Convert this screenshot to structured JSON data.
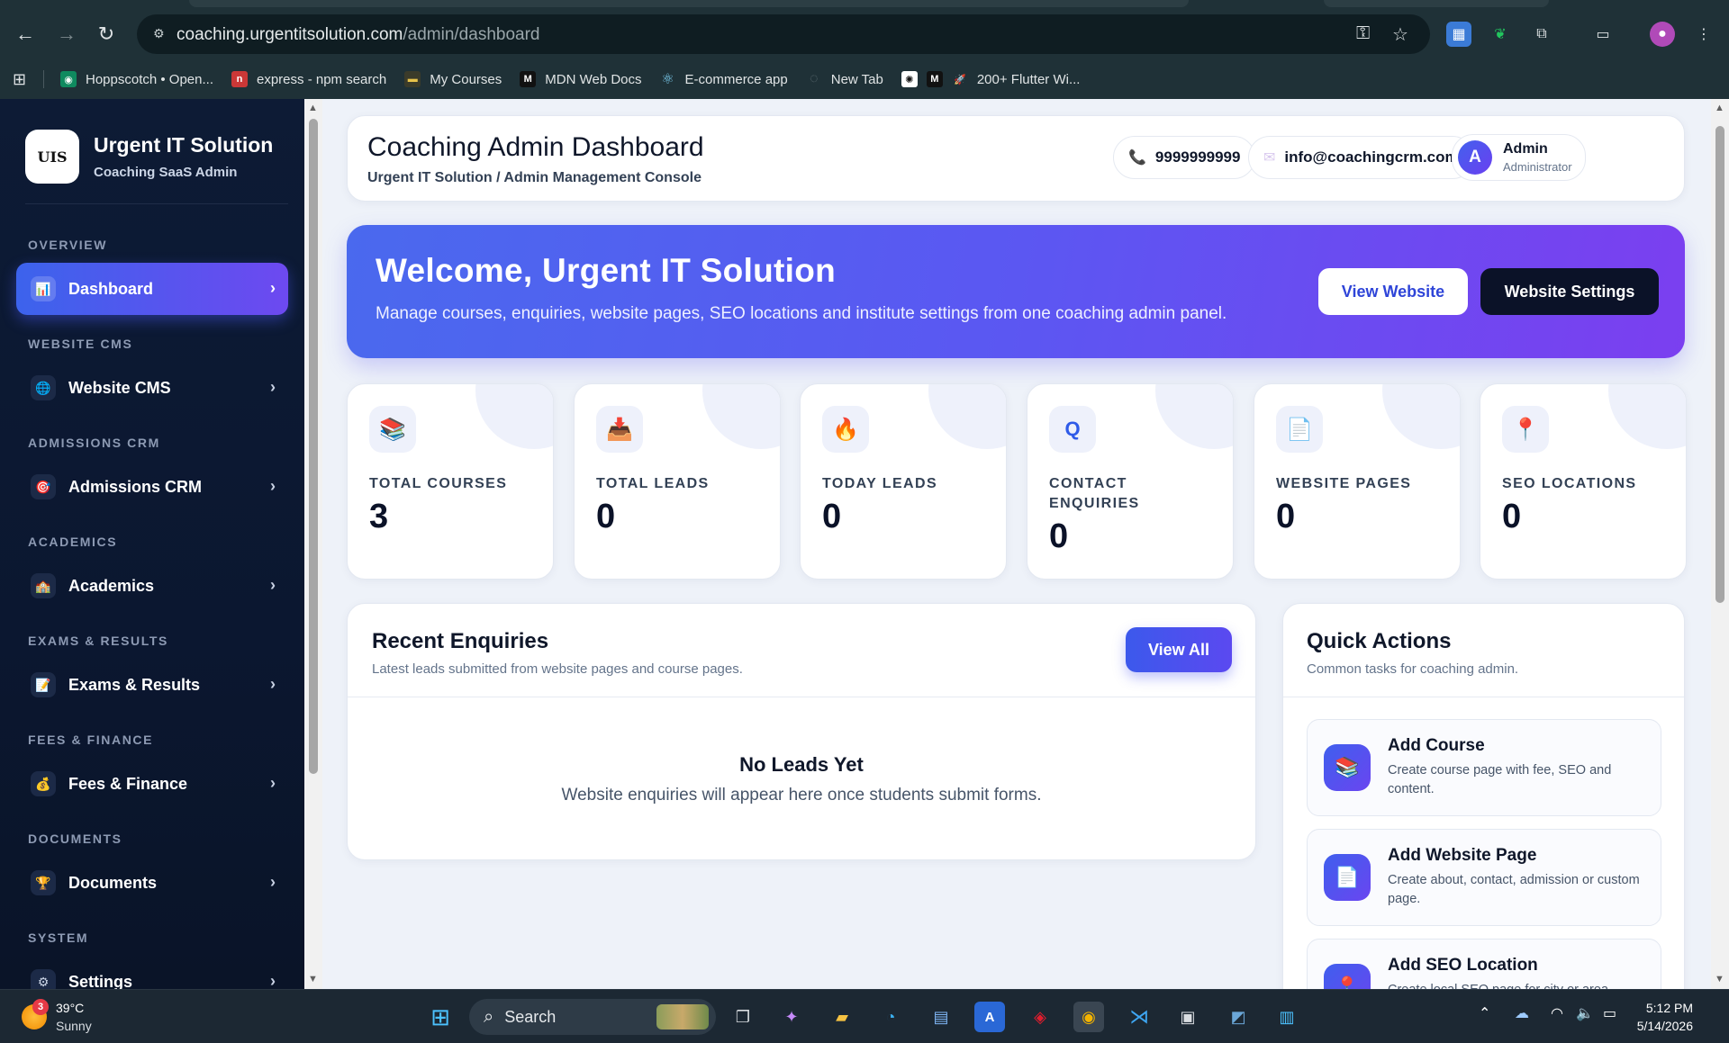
{
  "browser": {
    "url_host": "coaching.urgentitsolution.com",
    "url_path": "/admin/dashboard",
    "bookmarks": [
      {
        "label": "Hoppscotch • Open...",
        "icon": "hoppscotch-icon",
        "color": "#0f8a5f",
        "glyph": "◉"
      },
      {
        "label": "express - npm search",
        "icon": "npm-icon",
        "color": "#cb3837",
        "glyph": "n"
      },
      {
        "label": "My Courses",
        "icon": "courses-icon",
        "color": "#3b3b2a",
        "glyph": "▬"
      },
      {
        "label": "MDN Web Docs",
        "icon": "mdn-icon",
        "color": "#111111",
        "glyph": "M"
      },
      {
        "label": "E-commerce app",
        "icon": "react-icon",
        "color": "#1f3137",
        "glyph": "⚛"
      },
      {
        "label": "New Tab",
        "icon": "newtab-icon",
        "color": "#2b3a40",
        "glyph": "◌"
      },
      {
        "label": "",
        "icon": "openai-icon",
        "color": "#ffffff",
        "glyph": "✺"
      },
      {
        "label": "200+ Flutter Wi...",
        "icon": "medium-icon",
        "color": "#111111",
        "glyph": "M"
      }
    ]
  },
  "sidebar": {
    "brand_logo_text": "UIS",
    "brand_title": "Urgent IT Solution",
    "brand_subtitle": "Coaching SaaS Admin",
    "sections": [
      {
        "label": "OVERVIEW",
        "item": "Dashboard",
        "icon": "chart-icon",
        "glyph": "📊",
        "active": true
      },
      {
        "label": "WEBSITE CMS",
        "item": "Website CMS",
        "icon": "globe-icon",
        "glyph": "🌐",
        "active": false
      },
      {
        "label": "ADMISSIONS CRM",
        "item": "Admissions CRM",
        "icon": "target-icon",
        "glyph": "🎯",
        "active": false
      },
      {
        "label": "ACADEMICS",
        "item": "Academics",
        "icon": "school-icon",
        "glyph": "🏫",
        "active": false
      },
      {
        "label": "EXAMS & RESULTS",
        "item": "Exams & Results",
        "icon": "document-icon",
        "glyph": "📝",
        "active": false
      },
      {
        "label": "FEES & FINANCE",
        "item": "Fees & Finance",
        "icon": "money-bag-icon",
        "glyph": "💰",
        "active": false
      },
      {
        "label": "DOCUMENTS",
        "item": "Documents",
        "icon": "trophy-icon",
        "glyph": "🏆",
        "active": false
      },
      {
        "label": "SYSTEM",
        "item": "Settings",
        "icon": "gear-icon",
        "glyph": "⚙",
        "active": false
      }
    ],
    "chevron": "›"
  },
  "header": {
    "title": "Coaching Admin Dashboard",
    "subtitle": "Urgent IT Solution / Admin Management Console",
    "phone": "9999999999",
    "email": "info@coachingcrm.com",
    "user_initial": "A",
    "user_name": "Admin",
    "user_role": "Administrator"
  },
  "hero": {
    "title": "Welcome, Urgent IT Solution",
    "subtitle": "Manage courses, enquiries, website pages, SEO locations and institute settings from one coaching admin panel.",
    "btn_view": "View Website",
    "btn_settings": "Website Settings"
  },
  "stats": [
    {
      "label": "TOTAL COURSES",
      "value": "3",
      "icon": "books-icon",
      "glyph": "📚"
    },
    {
      "label": "TOTAL LEADS",
      "value": "0",
      "icon": "inbox-icon",
      "glyph": "📥"
    },
    {
      "label": "TODAY LEADS",
      "value": "0",
      "icon": "fire-icon",
      "glyph": "🔥"
    },
    {
      "label": "CONTACT ENQUIRIES",
      "value": "0",
      "icon": "search-icon",
      "glyph": "Q"
    },
    {
      "label": "WEBSITE PAGES",
      "value": "0",
      "icon": "page-icon",
      "glyph": "📄"
    },
    {
      "label": "SEO LOCATIONS",
      "value": "0",
      "icon": "pin-icon",
      "glyph": "📍"
    }
  ],
  "enquiries": {
    "title": "Recent Enquiries",
    "subtitle": "Latest leads submitted from website pages and course pages.",
    "view_all": "View All",
    "empty_title": "No Leads Yet",
    "empty_text": "Website enquiries will appear here once students submit forms."
  },
  "quick_actions": {
    "title": "Quick Actions",
    "subtitle": "Common tasks for coaching admin.",
    "items": [
      {
        "name": "Add Course",
        "desc": "Create course page with fee, SEO and content.",
        "icon": "books-icon",
        "glyph": "📚"
      },
      {
        "name": "Add Website Page",
        "desc": "Create about, contact, admission or custom page.",
        "icon": "page-icon",
        "glyph": "📄"
      },
      {
        "name": "Add SEO Location",
        "desc": "Create local SEO page for city or area.",
        "icon": "pin-icon",
        "glyph": "📍"
      }
    ]
  },
  "taskbar": {
    "weather_badge": "3",
    "temperature": "39°C",
    "condition": "Sunny",
    "search_label": "Search",
    "time": "5:12 PM",
    "date": "5/14/2026"
  }
}
